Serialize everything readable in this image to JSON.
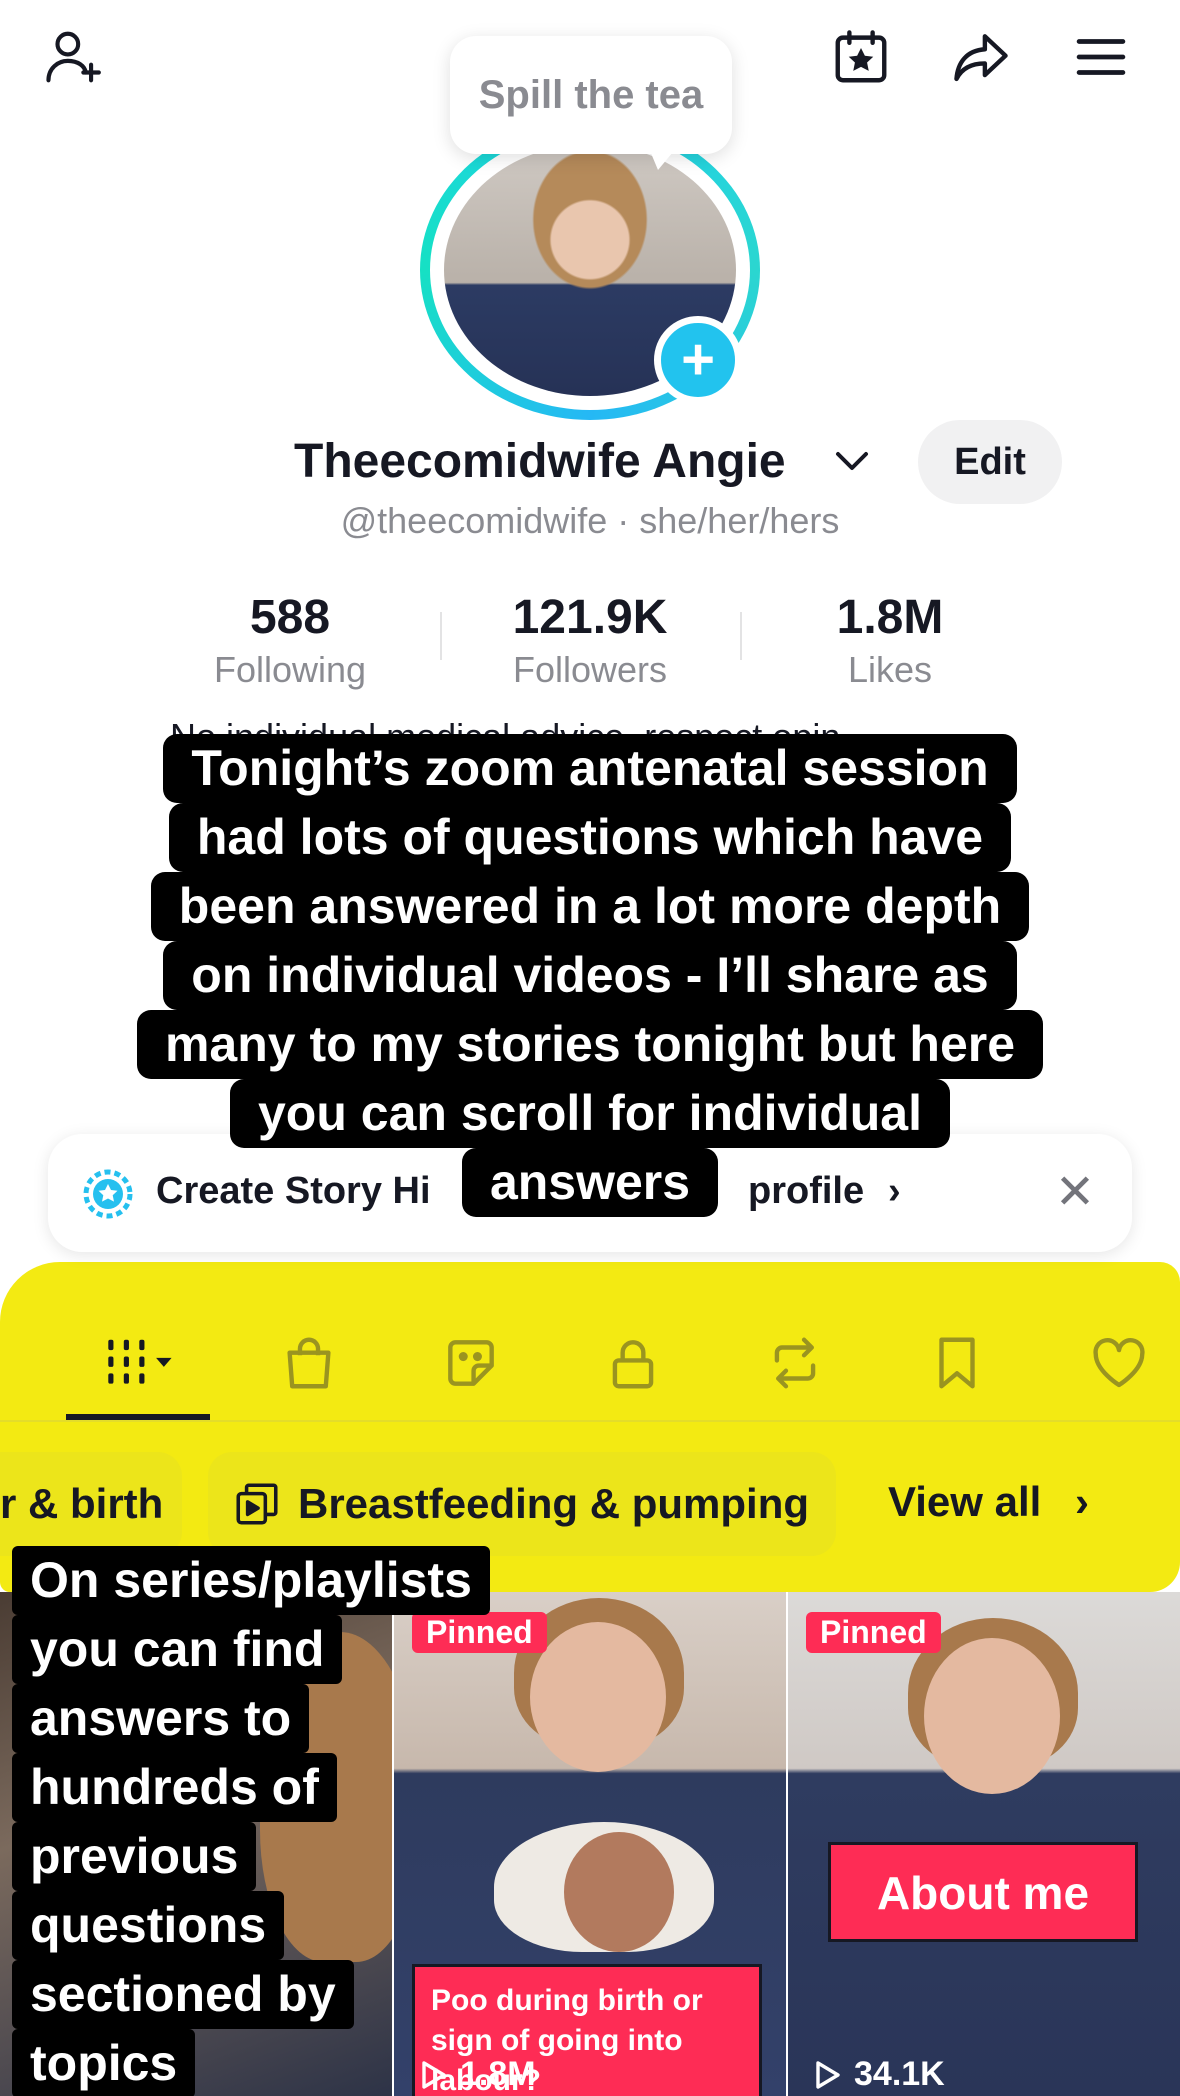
{
  "top_bar": {
    "icons": [
      "add-friend-icon",
      "calendar-star-icon",
      "share-icon",
      "menu-icon"
    ]
  },
  "tooltip": {
    "text": "Spill the tea"
  },
  "profile": {
    "display_name": "Theecomidwife Angie",
    "handle_line": "@theecomidwife · she/her/hers",
    "edit_label": "Edit",
    "bio_peek": "No individual medical advice, respect opin..."
  },
  "stats": [
    {
      "value": "588",
      "label": "Following"
    },
    {
      "value": "121.9K",
      "label": "Followers"
    },
    {
      "value": "1.8M",
      "label": "Likes"
    }
  ],
  "caption": {
    "lines": [
      "Tonight’s zoom antenatal session",
      "had lots of questions which have",
      "been answered in a lot more depth",
      "on individual videos - I’ll share as",
      "many to my stories tonight but here",
      "you can scroll for individual",
      "answers"
    ]
  },
  "story_banner": {
    "text_left": "Create Story Hi",
    "text_right": "profile",
    "chevron": "›",
    "close": "✕"
  },
  "tabs": [
    "videos-tab",
    "shop-tab",
    "sticker-tab",
    "private-tab",
    "repost-tab",
    "saved-tab",
    "liked-tab"
  ],
  "playlists": {
    "chip_partial": "r & birth",
    "chip_main": "Breastfeeding & pumping",
    "view_all": "View all",
    "view_all_chevron": "›"
  },
  "caption2": {
    "lines": [
      "On series/playlists",
      "you can find",
      "answers to",
      "hundreds of",
      "previous",
      "questions",
      "sectioned by",
      "topics"
    ]
  },
  "videos": [
    {
      "pinned": "",
      "title": "",
      "views": ""
    },
    {
      "pinned": "Pinned",
      "title": "Poo during birth or sign of going into labour?",
      "views": "1.8M"
    },
    {
      "pinned": "Pinned",
      "title": "About me",
      "views": "34.1K"
    }
  ],
  "colors": {
    "accent_pink": "#fe2c55",
    "ring_cyan": "#1fd2ea",
    "highlight_yellow": "#f3ea12",
    "text_primary": "#161823",
    "text_secondary": "#8a8b91"
  }
}
